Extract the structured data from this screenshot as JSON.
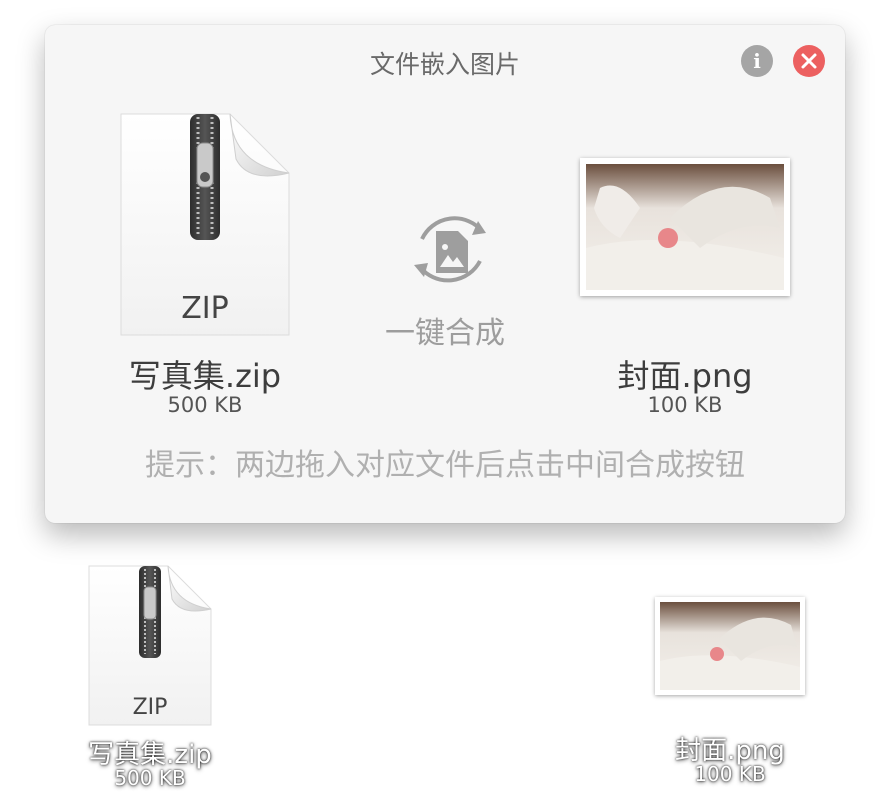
{
  "window": {
    "title": "文件嵌入图片",
    "info_icon": "i",
    "hint": "提示：两边拖入对应文件后点击中间合成按钮",
    "merge_label": "一键合成"
  },
  "zip_file": {
    "icon_label": "ZIP",
    "name": "写真集.zip",
    "size": "500 KB"
  },
  "image_file": {
    "name": "封面.png",
    "size": "100 KB"
  },
  "dragging": {
    "zip": {
      "icon_label": "ZIP",
      "name": "写真集.zip",
      "size": "500 KB"
    },
    "image": {
      "name": "封面.png",
      "size": "100 KB"
    }
  },
  "colors": {
    "close": "#ec6060",
    "info": "#a5a5a5",
    "window_bg": "#f6f6f6"
  }
}
